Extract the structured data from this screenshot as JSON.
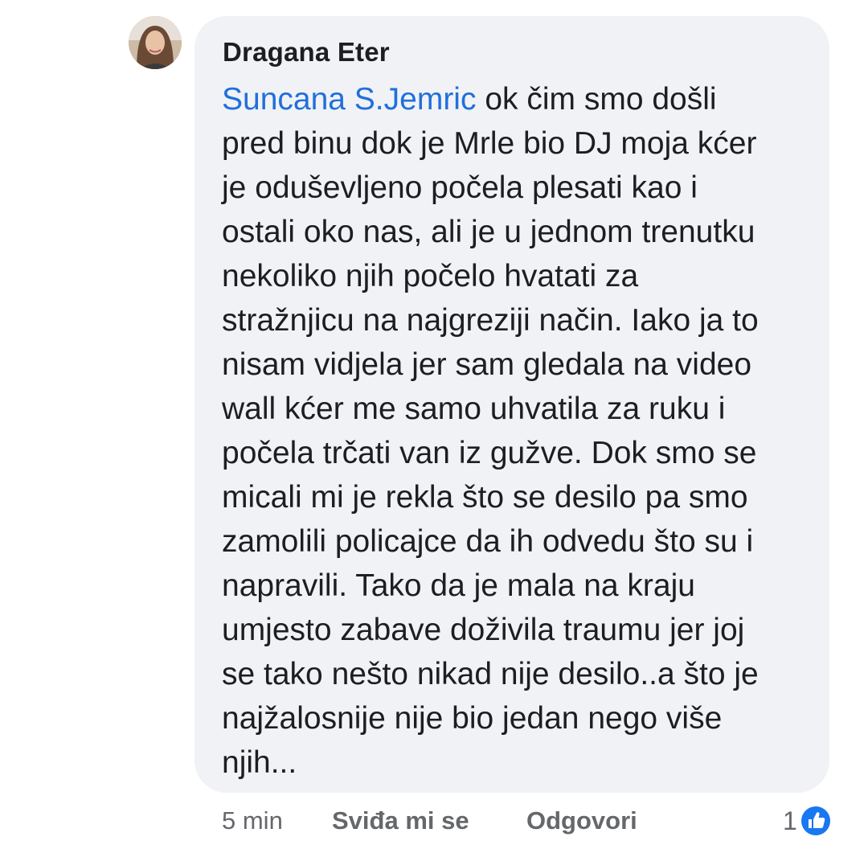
{
  "comment": {
    "author": "Dragana Eter",
    "mention": "Suncana S.Jemric",
    "lines": [
      " ok čim smo došli",
      "pred binu dok je Mrle bio DJ moja kćer",
      "je oduševljeno počela plesati kao i",
      "ostali oko nas, ali je u jednom trenutku",
      "nekoliko njih počelo hvatati za",
      "stražnjicu na najgreziji način. Iako ja to",
      "nisam vidjela jer sam gledala na video",
      "wall kćer me samo uhvatila za ruku i",
      "počela trčati van iz gužve. Dok smo se",
      "micali mi je rekla što se desilo pa smo",
      "zamolili policajce da ih odvedu što su i",
      "napravili. Tako da je mala na kraju",
      "umjesto zabave doživila traumu jer joj",
      "se tako nešto nikad nije desilo..a što je",
      "najžalosnije nije bio jedan nego više",
      "njih..."
    ]
  },
  "actions": {
    "time": "5 min",
    "like_label": "Sviđa mi se",
    "reply_label": "Odgovori",
    "reaction_count": "1",
    "reaction_icon": "thumbs-up-icon"
  },
  "colors": {
    "bubble": "#f0f2f5",
    "mention": "#216fdb",
    "meta": "#65676b",
    "like_badge": "#1877f2"
  }
}
